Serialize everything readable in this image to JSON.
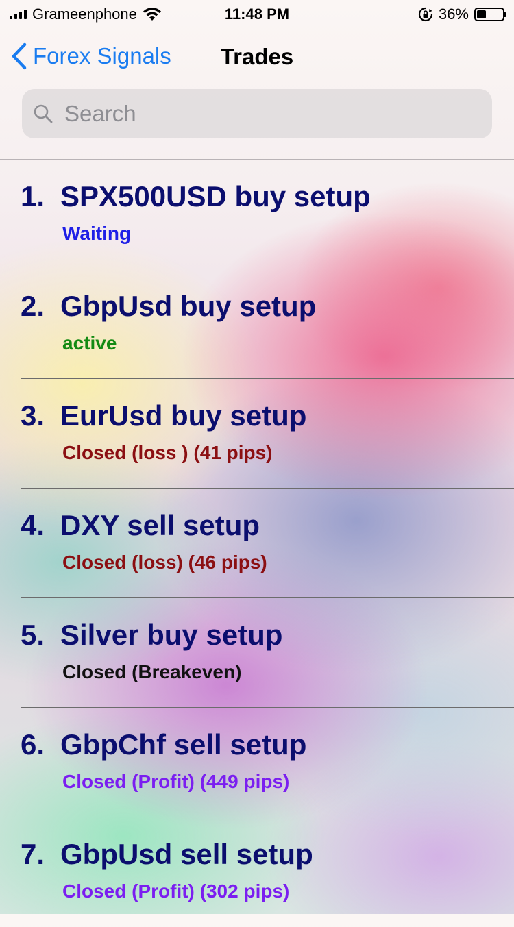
{
  "status_bar": {
    "carrier": "Grameenphone",
    "time": "11:48 PM",
    "battery": "36%",
    "battery_level": 0.36,
    "icons": [
      "signal-icon",
      "wifi-icon",
      "rotation-lock-icon",
      "battery-icon"
    ]
  },
  "nav": {
    "back_label": "Forex Signals",
    "title": "Trades"
  },
  "search": {
    "placeholder": "Search",
    "value": ""
  },
  "colors": {
    "title": "#0b0e6e",
    "back": "#1a7cf0",
    "waiting": "#1f1fe6",
    "active": "#138a13",
    "loss": "#8b0f12",
    "breakeven": "#111111",
    "profit": "#7b1ef0"
  },
  "trades": [
    {
      "num": "1.",
      "title": "SPX500USD buy setup",
      "status": "Waiting",
      "status_color": "#1f1fe6"
    },
    {
      "num": "2.",
      "title": "GbpUsd buy setup",
      "status": "active",
      "status_color": "#138a13"
    },
    {
      "num": "3.",
      "title": "EurUsd buy setup",
      "status": "Closed (loss ) (41 pips)",
      "status_color": "#8b0f12"
    },
    {
      "num": "4.",
      "title": "DXY sell setup",
      "status": "Closed (loss) (46 pips)",
      "status_color": "#8b0f12"
    },
    {
      "num": "5.",
      "title": "Silver buy setup",
      "status": "Closed (Breakeven)",
      "status_color": "#111111"
    },
    {
      "num": "6.",
      "title": "GbpChf sell setup",
      "status": "Closed (Profit) (449 pips)",
      "status_color": "#7b1ef0"
    },
    {
      "num": "7.",
      "title": "GbpUsd sell setup",
      "status": "Closed (Profit) (302 pips)",
      "status_color": "#7b1ef0"
    }
  ]
}
